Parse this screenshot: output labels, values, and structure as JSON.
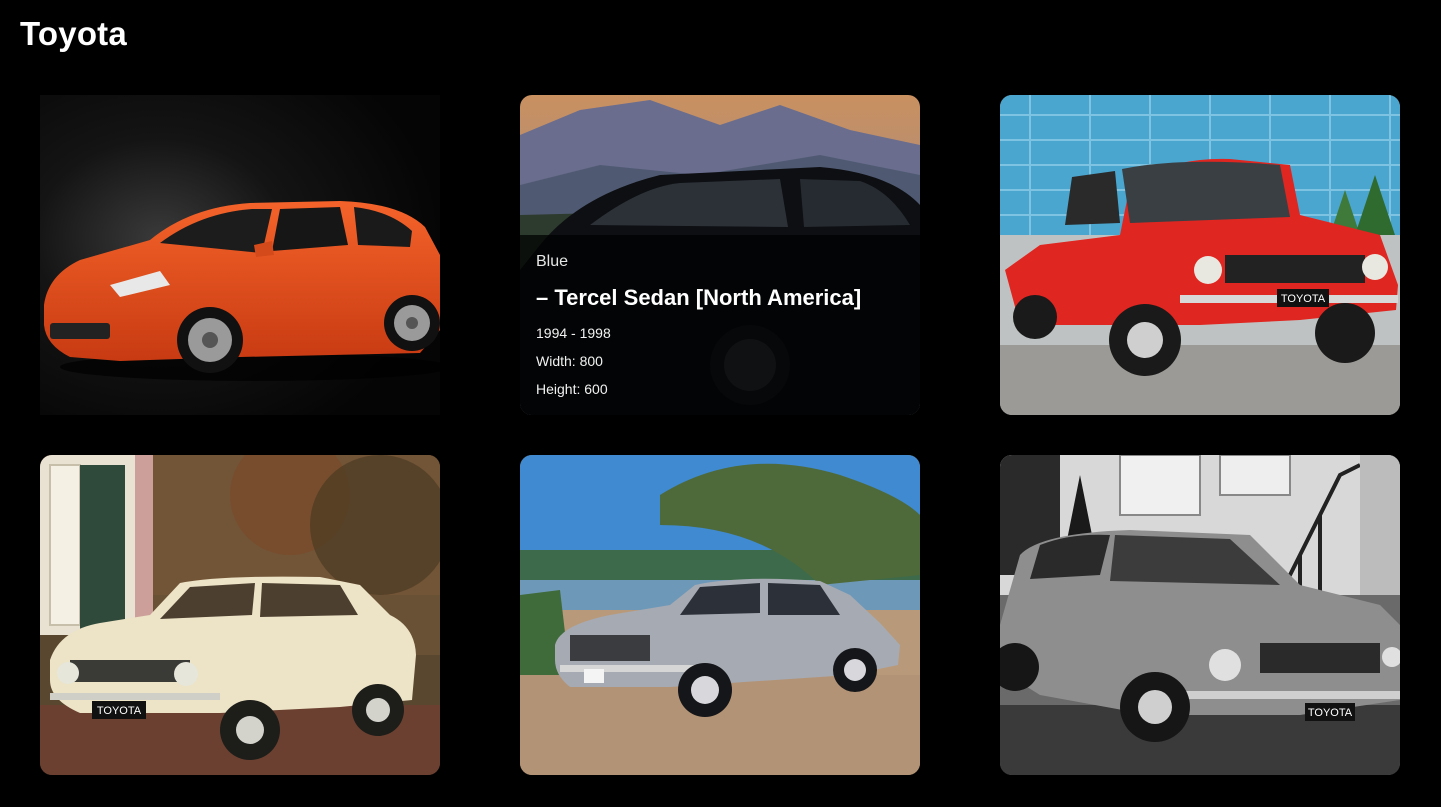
{
  "brand": "Toyota",
  "cards": [
    {
      "name": "aqua-orange-hatchback"
    },
    {
      "name": "tercel-sedan",
      "overlay": {
        "color": "Blue",
        "model": "– Tercel Sedan [North America]",
        "years": "1994 - 1998",
        "width": "Width: 800",
        "height": "Height: 600"
      }
    },
    {
      "name": "corolla-red-coupe",
      "plate": "TOYOTA"
    },
    {
      "name": "corolla-cream-sedan",
      "plate": "TOYOTA"
    },
    {
      "name": "cressida-silver-sedan"
    },
    {
      "name": "corona-bw-coupe",
      "plate": "TOYOTA"
    }
  ]
}
